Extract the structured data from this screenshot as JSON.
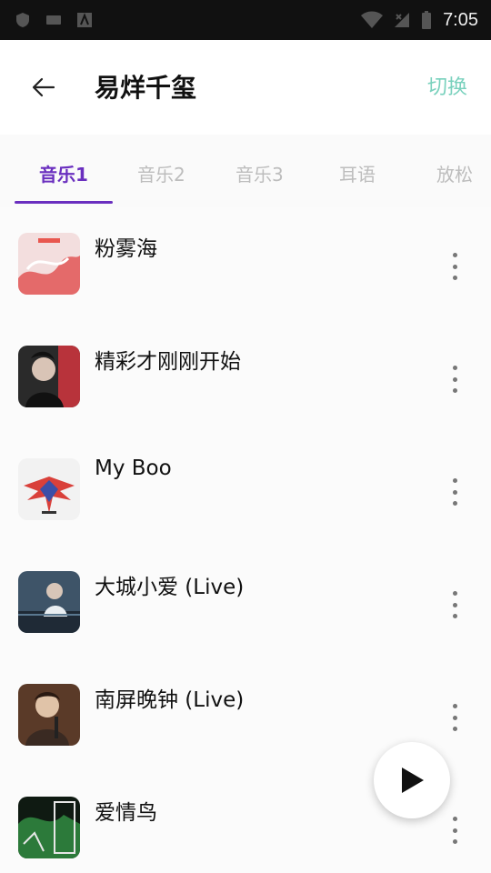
{
  "status_bar": {
    "time": "7:05",
    "icons": [
      "shield-icon",
      "keyboard-icon",
      "app-a-icon",
      "wifi-icon",
      "no-signal-icon",
      "battery-icon"
    ]
  },
  "header": {
    "title": "易烊千玺",
    "switch_label": "切换"
  },
  "tabs": [
    {
      "label": "音乐1",
      "active": true
    },
    {
      "label": "音乐2",
      "active": false
    },
    {
      "label": "音乐3",
      "active": false
    },
    {
      "label": "耳语",
      "active": false
    },
    {
      "label": "放松",
      "active": false
    }
  ],
  "colors": {
    "accent": "#6a2fbf",
    "switch": "#79d1bd",
    "muted": "#bdbdbd"
  },
  "songs": [
    {
      "title": "粉雾海"
    },
    {
      "title": "精彩才刚刚开始"
    },
    {
      "title": "My Boo"
    },
    {
      "title": "大城小爱 (Live)"
    },
    {
      "title": "南屏晚钟 (Live)"
    },
    {
      "title": "爱情鸟"
    }
  ]
}
